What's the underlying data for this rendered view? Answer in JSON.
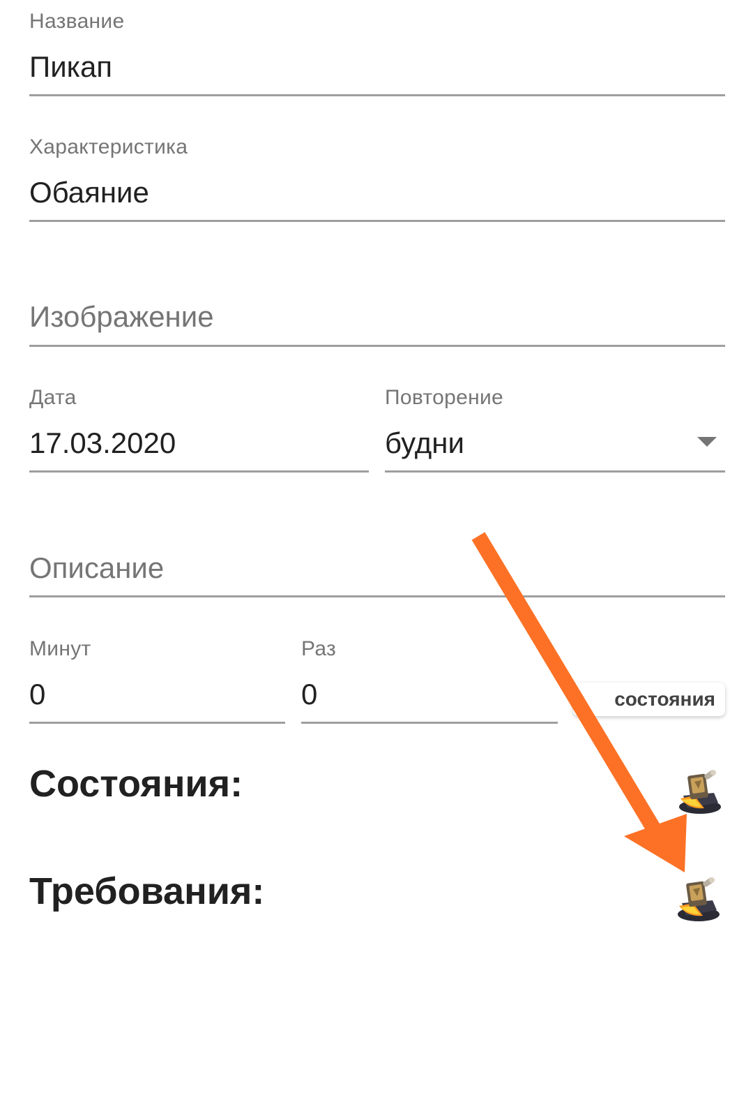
{
  "form": {
    "name": {
      "label": "Название",
      "value": "Пикап"
    },
    "characteristic": {
      "label": "Характеристика",
      "value": "Обаяние"
    },
    "image": {
      "placeholder": "Изображение"
    },
    "date": {
      "label": "Дата",
      "value": "17.03.2020"
    },
    "repeat": {
      "label": "Повторение",
      "value": "будни"
    },
    "description": {
      "placeholder": "Описание"
    },
    "minutes": {
      "label": "Минут",
      "value": "0"
    },
    "times": {
      "label": "Раз",
      "value": "0"
    }
  },
  "tooltip": {
    "text": "состояния"
  },
  "sections": {
    "states": {
      "title": "Состояния:"
    },
    "requirements": {
      "title": "Требования:"
    }
  },
  "icons": {
    "states_add": "anvil-icon",
    "requirements_add": "anvil-icon"
  },
  "colors": {
    "arrow": "#fd7126",
    "underline": "#9e9e9e",
    "label": "#757575",
    "text": "#212121"
  }
}
